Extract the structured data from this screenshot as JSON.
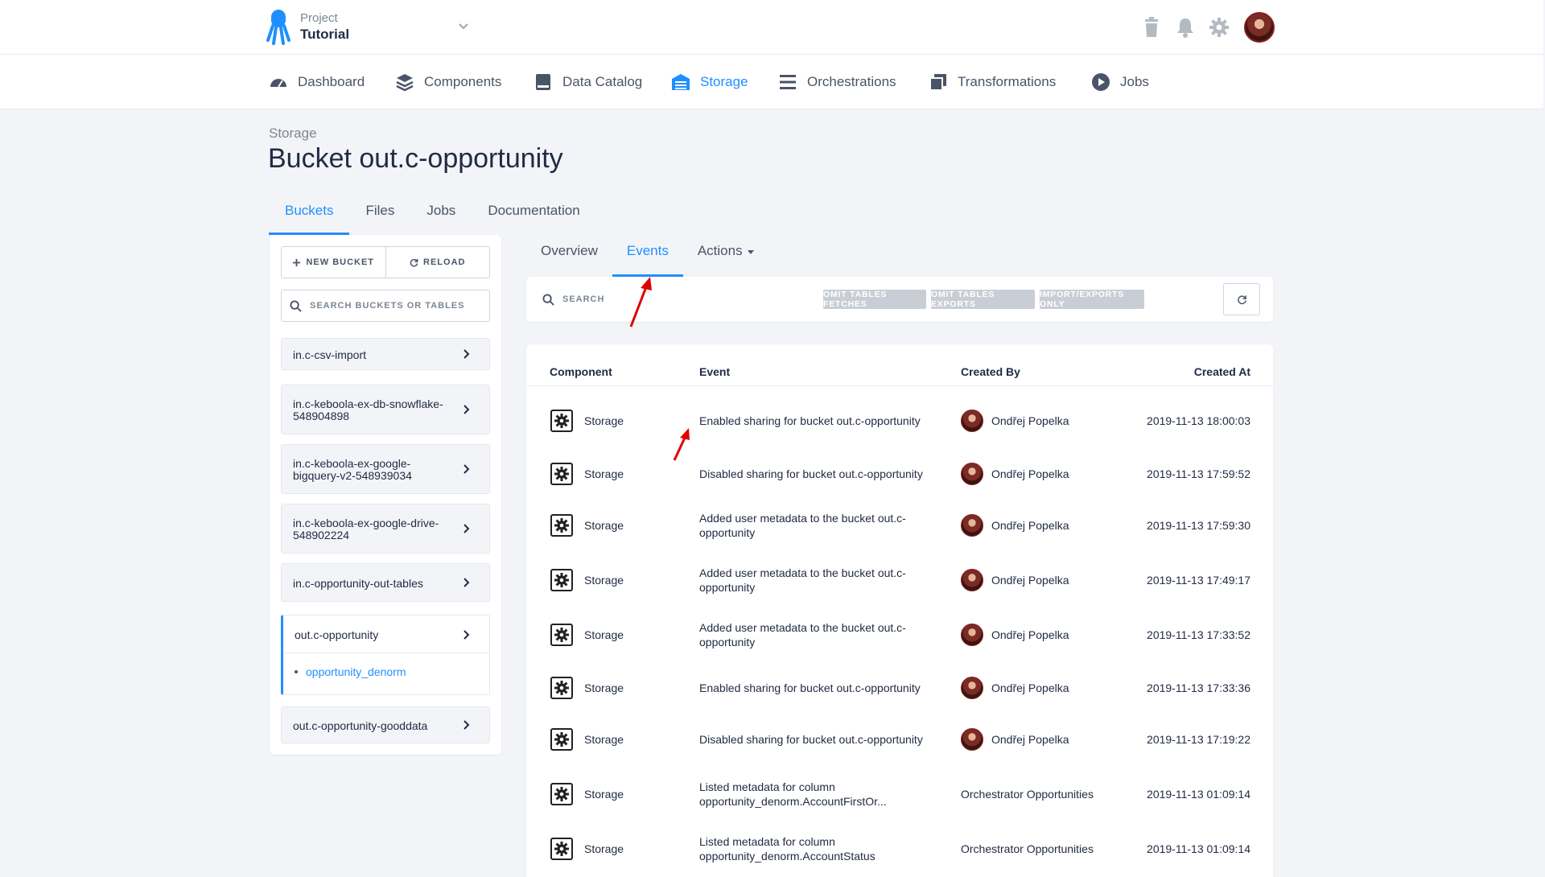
{
  "header": {
    "project_label": "Project",
    "project_name": "Tutorial",
    "icons": [
      "trash-icon",
      "bell-icon",
      "gear-icon",
      "user-avatar"
    ]
  },
  "nav": [
    {
      "label": "Dashboard",
      "icon": "dashboard-icon"
    },
    {
      "label": "Components",
      "icon": "layers-icon"
    },
    {
      "label": "Data Catalog",
      "icon": "book-icon"
    },
    {
      "label": "Storage",
      "icon": "warehouse-icon",
      "active": true
    },
    {
      "label": "Orchestrations",
      "icon": "list-icon"
    },
    {
      "label": "Transformations",
      "icon": "transform-icon"
    },
    {
      "label": "Jobs",
      "icon": "play-icon"
    }
  ],
  "page": {
    "breadcrumb": "Storage",
    "title": "Bucket out.c-opportunity",
    "tabs": [
      "Buckets",
      "Files",
      "Jobs",
      "Documentation"
    ],
    "active_tab": "Buckets"
  },
  "sidebar": {
    "new_bucket_label": "NEW BUCKET",
    "reload_label": "RELOAD",
    "search_placeholder": "SEARCH BUCKETS OR TABLES",
    "buckets": [
      {
        "name": "in.c-csv-import"
      },
      {
        "name": "in.c-keboola-ex-db-snowflake-548904898"
      },
      {
        "name": "in.c-keboola-ex-google-bigquery-v2-548939034"
      },
      {
        "name": "in.c-keboola-ex-google-drive-548902224"
      },
      {
        "name": "in.c-opportunity-out-tables"
      },
      {
        "name": "out.c-opportunity",
        "selected": true,
        "tables": [
          "opportunity_denorm"
        ]
      },
      {
        "name": "out.c-opportunity-gooddata"
      }
    ]
  },
  "detail": {
    "subtabs": [
      "Overview",
      "Events",
      "Actions"
    ],
    "active_subtab": "Events",
    "search_placeholder": "SEARCH",
    "filters": [
      "OMIT TABLES FETCHES",
      "OMIT TABLES EXPORTS",
      "IMPORT/EXPORTS ONLY"
    ],
    "columns": [
      "Component",
      "Event",
      "Created By",
      "Created At"
    ],
    "events": [
      {
        "component": "Storage",
        "event": "Enabled sharing for bucket out.c-opportunity",
        "created_by": "Ondřej Popelka",
        "avatar": true,
        "created_at": "2019-11-13 18:00:03"
      },
      {
        "component": "Storage",
        "event": "Disabled sharing for bucket out.c-opportunity",
        "created_by": "Ondřej Popelka",
        "avatar": true,
        "created_at": "2019-11-13 17:59:52"
      },
      {
        "component": "Storage",
        "event": "Added user metadata to the bucket out.c-opportunity",
        "created_by": "Ondřej Popelka",
        "avatar": true,
        "created_at": "2019-11-13 17:59:30"
      },
      {
        "component": "Storage",
        "event": "Added user metadata to the bucket out.c-opportunity",
        "created_by": "Ondřej Popelka",
        "avatar": true,
        "created_at": "2019-11-13 17:49:17"
      },
      {
        "component": "Storage",
        "event": "Added user metadata to the bucket out.c-opportunity",
        "created_by": "Ondřej Popelka",
        "avatar": true,
        "created_at": "2019-11-13 17:33:52"
      },
      {
        "component": "Storage",
        "event": "Enabled sharing for bucket out.c-opportunity",
        "created_by": "Ondřej Popelka",
        "avatar": true,
        "created_at": "2019-11-13 17:33:36"
      },
      {
        "component": "Storage",
        "event": "Disabled sharing for bucket out.c-opportunity",
        "created_by": "Ondřej Popelka",
        "avatar": true,
        "created_at": "2019-11-13 17:19:22"
      },
      {
        "component": "Storage",
        "event": "Listed metadata for column opportunity_denorm.AccountFirstOr...",
        "created_by": "Orchestrator Opportunities",
        "avatar": false,
        "created_at": "2019-11-13 01:09:14"
      },
      {
        "component": "Storage",
        "event": "Listed metadata for column opportunity_denorm.AccountStatus",
        "created_by": "Orchestrator Opportunities",
        "avatar": false,
        "created_at": "2019-11-13 01:09:14"
      }
    ]
  },
  "colors": {
    "accent": "#1f8fff",
    "annotation_arrow": "#e00000",
    "filter_button": "#c9ced6"
  }
}
